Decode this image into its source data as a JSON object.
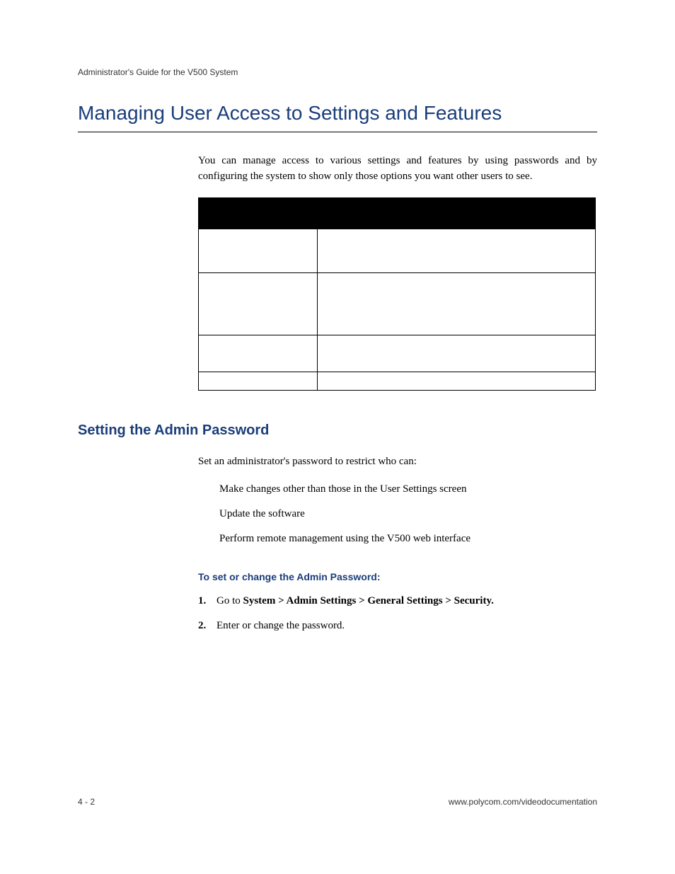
{
  "header": "Administrator's Guide for the V500 System",
  "mainHeading": "Managing User Access to Settings and Features",
  "intro": "You can manage access to various settings and features by using passwords and by configuring the system to show only those options you want other users to see.",
  "sectionHeading": "Setting the Admin Password",
  "sectionIntro": "Set an administrator's password to restrict who can:",
  "bullets": [
    "Make changes other than those in the User Settings screen",
    "Update the software",
    "Perform remote management using the V500 web interface"
  ],
  "subHeading": "To set or change the Admin Password:",
  "steps": [
    {
      "num": "1.",
      "prefix": "Go to ",
      "bold": "System > Admin Settings > General Settings > Security.",
      "suffix": ""
    },
    {
      "num": "2.",
      "prefix": "Enter or change the password.",
      "bold": "",
      "suffix": ""
    }
  ],
  "footer": {
    "left": "4 - 2",
    "right": "www.polycom.com/videodocumentation"
  }
}
